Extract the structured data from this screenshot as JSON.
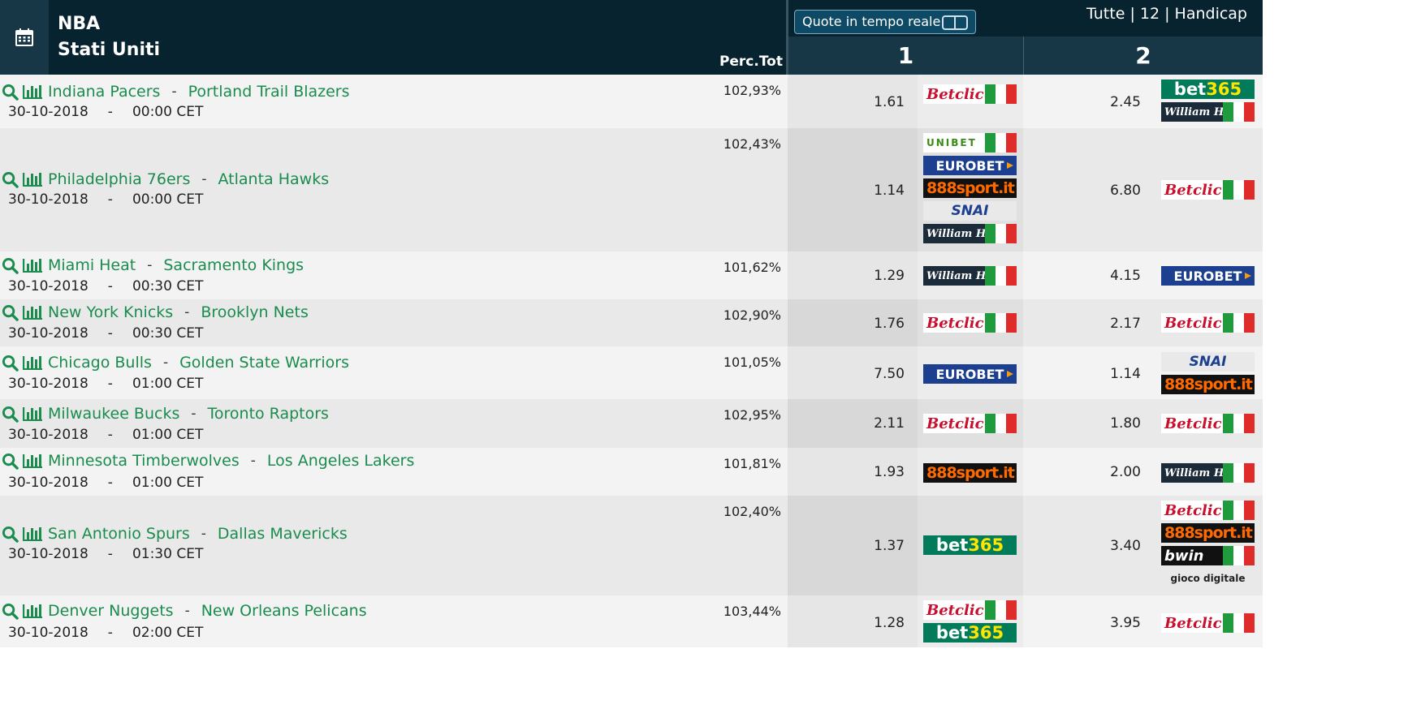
{
  "header": {
    "league": "NBA",
    "country": "Stati Uniti",
    "perc_label": "Perc.Tot",
    "live_button": "Quote in tempo reale",
    "filters": "Tutte | 12 | Handicap",
    "col1": "1",
    "col2": "2"
  },
  "bookmakers": {
    "betclic": "Betclic",
    "eurobet": "EUROBET",
    "s888": "888sport.it",
    "snai": "SNAI",
    "bet365_a": "bet",
    "bet365_b": "365",
    "william": "William HILL",
    "unibet": "UNIBET",
    "bwin": "bwin",
    "gioco": "gioco digitale"
  },
  "matches": [
    {
      "home": "Indiana Pacers",
      "away": "Portland Trail Blazers",
      "date": "30-10-2018",
      "time": "00:00 CET",
      "perc": "102,93%",
      "odd1": "1.61",
      "odd2": "2.45",
      "bk1": [
        "betclic"
      ],
      "bk2": [
        "bet365",
        "william"
      ]
    },
    {
      "home": "Philadelphia 76ers",
      "away": "Atlanta Hawks",
      "date": "30-10-2018",
      "time": "00:00 CET",
      "perc": "102,43%",
      "odd1": "1.14",
      "odd2": "6.80",
      "bk1": [
        "unibet",
        "eurobet",
        "s888",
        "snai",
        "william"
      ],
      "bk2": [
        "betclic"
      ]
    },
    {
      "home": "Miami Heat",
      "away": "Sacramento Kings",
      "date": "30-10-2018",
      "time": "00:30 CET",
      "perc": "101,62%",
      "odd1": "1.29",
      "odd2": "4.15",
      "bk1": [
        "william"
      ],
      "bk2": [
        "eurobet"
      ]
    },
    {
      "home": "New York Knicks",
      "away": "Brooklyn Nets",
      "date": "30-10-2018",
      "time": "00:30 CET",
      "perc": "102,90%",
      "odd1": "1.76",
      "odd2": "2.17",
      "bk1": [
        "betclic"
      ],
      "bk2": [
        "betclic"
      ]
    },
    {
      "home": "Chicago Bulls",
      "away": "Golden State Warriors",
      "date": "30-10-2018",
      "time": "01:00 CET",
      "perc": "101,05%",
      "odd1": "7.50",
      "odd2": "1.14",
      "bk1": [
        "eurobet"
      ],
      "bk2": [
        "snai",
        "s888"
      ]
    },
    {
      "home": "Milwaukee Bucks",
      "away": "Toronto Raptors",
      "date": "30-10-2018",
      "time": "01:00 CET",
      "perc": "102,95%",
      "odd1": "2.11",
      "odd2": "1.80",
      "bk1": [
        "betclic"
      ],
      "bk2": [
        "betclic"
      ]
    },
    {
      "home": "Minnesota Timberwolves",
      "away": "Los Angeles Lakers",
      "date": "30-10-2018",
      "time": "01:00 CET",
      "perc": "101,81%",
      "odd1": "1.93",
      "odd2": "2.00",
      "bk1": [
        "s888"
      ],
      "bk2": [
        "william"
      ]
    },
    {
      "home": "San Antonio Spurs",
      "away": "Dallas Mavericks",
      "date": "30-10-2018",
      "time": "01:30 CET",
      "perc": "102,40%",
      "odd1": "1.37",
      "odd2": "3.40",
      "bk1": [
        "bet365"
      ],
      "bk2": [
        "betclic",
        "s888",
        "bwin",
        "gioco"
      ]
    },
    {
      "home": "Denver Nuggets",
      "away": "New Orleans Pelicans",
      "date": "30-10-2018",
      "time": "02:00 CET",
      "perc": "103,44%",
      "odd1": "1.28",
      "odd2": "3.95",
      "bk1": [
        "betclic",
        "bet365"
      ],
      "bk2": [
        "betclic"
      ]
    }
  ]
}
